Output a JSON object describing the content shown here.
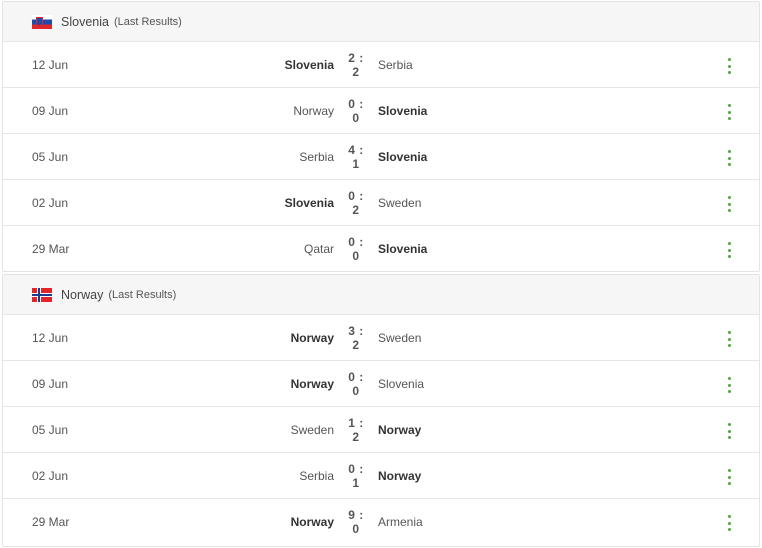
{
  "sections": [
    {
      "team": "Slovenia",
      "subtitle": "(Last Results)",
      "matches": [
        {
          "date": "12 Jun",
          "home": "Slovenia",
          "score": "2 : 2",
          "away": "Serbia",
          "bold": "home"
        },
        {
          "date": "09 Jun",
          "home": "Norway",
          "score": "0 : 0",
          "away": "Slovenia",
          "bold": "away"
        },
        {
          "date": "05 Jun",
          "home": "Serbia",
          "score": "4 : 1",
          "away": "Slovenia",
          "bold": "away"
        },
        {
          "date": "02 Jun",
          "home": "Slovenia",
          "score": "0 : 2",
          "away": "Sweden",
          "bold": "home"
        },
        {
          "date": "29 Mar",
          "home": "Qatar",
          "score": "0 : 0",
          "away": "Slovenia",
          "bold": "away"
        }
      ]
    },
    {
      "team": "Norway",
      "subtitle": "(Last Results)",
      "matches": [
        {
          "date": "12 Jun",
          "home": "Norway",
          "score": "3 : 2",
          "away": "Sweden",
          "bold": "home"
        },
        {
          "date": "09 Jun",
          "home": "Norway",
          "score": "0 : 0",
          "away": "Slovenia",
          "bold": "home"
        },
        {
          "date": "05 Jun",
          "home": "Sweden",
          "score": "1 : 2",
          "away": "Norway",
          "bold": "away"
        },
        {
          "date": "02 Jun",
          "home": "Serbia",
          "score": "0 : 1",
          "away": "Norway",
          "bold": "away"
        },
        {
          "date": "29 Mar",
          "home": "Norway",
          "score": "9 : 0",
          "away": "Armenia",
          "bold": "home"
        }
      ]
    }
  ],
  "icons": {
    "flag_0": "slovenia-flag-icon",
    "flag_1": "norway-flag-icon",
    "menu": "more-vertical-icon"
  },
  "colors": {
    "accent": "#4fa83d",
    "header_bg": "#f6f6f6",
    "border": "#e3e3e3"
  }
}
